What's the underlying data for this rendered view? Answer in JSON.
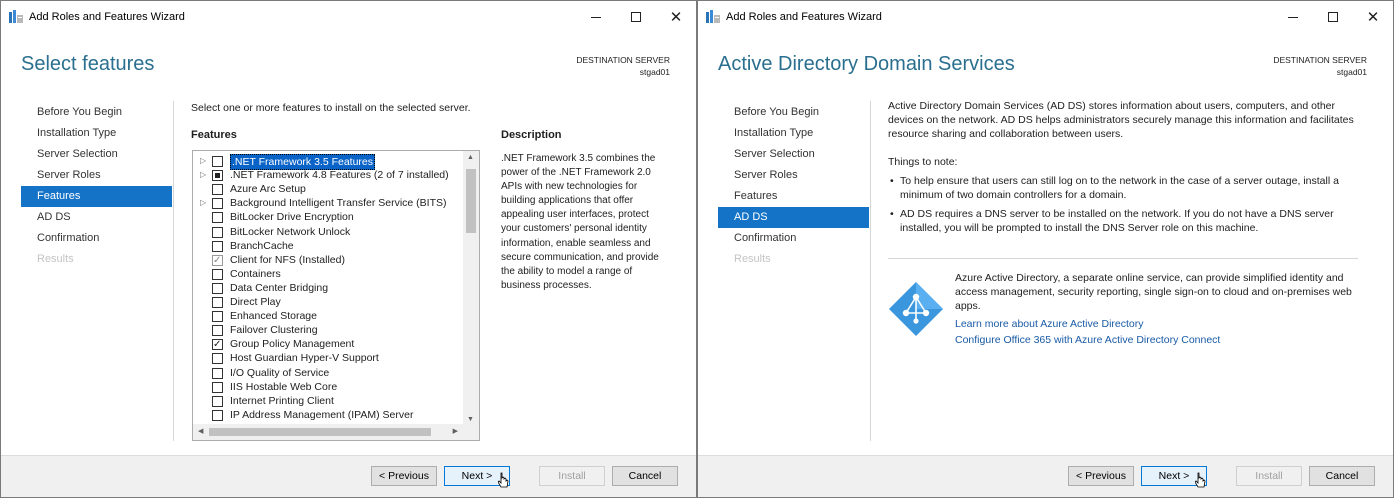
{
  "left": {
    "title": "Add Roles and Features Wizard",
    "heading": "Select features",
    "destination_label": "DESTINATION SERVER",
    "destination_server": "stgad01",
    "nav": [
      {
        "label": "Before You Begin",
        "state": "normal"
      },
      {
        "label": "Installation Type",
        "state": "normal"
      },
      {
        "label": "Server Selection",
        "state": "normal"
      },
      {
        "label": "Server Roles",
        "state": "normal"
      },
      {
        "label": "Features",
        "state": "active"
      },
      {
        "label": "AD DS",
        "state": "normal"
      },
      {
        "label": "Confirmation",
        "state": "normal"
      },
      {
        "label": "Results",
        "state": "disabled"
      }
    ],
    "intro": "Select one or more features to install on the selected server.",
    "features_label": "Features",
    "description_label": "Description",
    "description_text": ".NET Framework 3.5 combines the power of the .NET Framework 2.0 APIs with new technologies for building applications that offer appealing user interfaces, protect your customers' personal identity information, enable seamless and secure communication, and provide the ability to model a range of business processes.",
    "features": [
      {
        "label": ".NET Framework 3.5 Features",
        "expandable": true,
        "state": "unchecked",
        "selected": true
      },
      {
        "label": ".NET Framework 4.8 Features (2 of 7 installed)",
        "expandable": true,
        "state": "partial",
        "selected": false
      },
      {
        "label": "Azure Arc Setup",
        "expandable": false,
        "state": "unchecked",
        "selected": false
      },
      {
        "label": "Background Intelligent Transfer Service (BITS)",
        "expandable": true,
        "state": "unchecked",
        "selected": false
      },
      {
        "label": "BitLocker Drive Encryption",
        "expandable": false,
        "state": "unchecked",
        "selected": false
      },
      {
        "label": "BitLocker Network Unlock",
        "expandable": false,
        "state": "unchecked",
        "selected": false
      },
      {
        "label": "BranchCache",
        "expandable": false,
        "state": "unchecked",
        "selected": false
      },
      {
        "label": "Client for NFS (Installed)",
        "expandable": false,
        "state": "checked-grey",
        "selected": false
      },
      {
        "label": "Containers",
        "expandable": false,
        "state": "unchecked",
        "selected": false
      },
      {
        "label": "Data Center Bridging",
        "expandable": false,
        "state": "unchecked",
        "selected": false
      },
      {
        "label": "Direct Play",
        "expandable": false,
        "state": "unchecked",
        "selected": false
      },
      {
        "label": "Enhanced Storage",
        "expandable": false,
        "state": "unchecked",
        "selected": false
      },
      {
        "label": "Failover Clustering",
        "expandable": false,
        "state": "unchecked",
        "selected": false
      },
      {
        "label": "Group Policy Management",
        "expandable": false,
        "state": "checked",
        "selected": false
      },
      {
        "label": "Host Guardian Hyper-V Support",
        "expandable": false,
        "state": "unchecked",
        "selected": false
      },
      {
        "label": "I/O Quality of Service",
        "expandable": false,
        "state": "unchecked",
        "selected": false
      },
      {
        "label": "IIS Hostable Web Core",
        "expandable": false,
        "state": "unchecked",
        "selected": false
      },
      {
        "label": "Internet Printing Client",
        "expandable": false,
        "state": "unchecked",
        "selected": false
      },
      {
        "label": "IP Address Management (IPAM) Server",
        "expandable": false,
        "state": "unchecked",
        "selected": false
      }
    ],
    "buttons": {
      "previous": "< Previous",
      "next": "Next >",
      "install": "Install",
      "cancel": "Cancel"
    }
  },
  "right": {
    "title": "Add Roles and Features Wizard",
    "heading": "Active Directory Domain Services",
    "destination_label": "DESTINATION SERVER",
    "destination_server": "stgad01",
    "nav": [
      {
        "label": "Before You Begin",
        "state": "normal"
      },
      {
        "label": "Installation Type",
        "state": "normal"
      },
      {
        "label": "Server Selection",
        "state": "normal"
      },
      {
        "label": "Server Roles",
        "state": "normal"
      },
      {
        "label": "Features",
        "state": "normal"
      },
      {
        "label": "AD DS",
        "state": "active"
      },
      {
        "label": "Confirmation",
        "state": "normal"
      },
      {
        "label": "Results",
        "state": "disabled"
      }
    ],
    "intro": "Active Directory Domain Services (AD DS) stores information about users, computers, and other devices on the network.  AD DS helps administrators securely manage this information and facilitates resource sharing and collaboration between users.",
    "notes_label": "Things to note:",
    "bullets": [
      "To help ensure that users can still log on to the network in the case of a server outage, install a minimum of two domain controllers for a domain.",
      "AD DS requires a DNS server to be installed on the network.  If you do not have a DNS server installed, you will be prompted to install the DNS Server role on this machine."
    ],
    "azure_text": "Azure Active Directory, a separate online service, can provide simplified identity and access management, security reporting, single sign-on to cloud and on-premises web apps.",
    "links": [
      "Learn more about Azure Active Directory",
      "Configure Office 365 with Azure Active Directory Connect"
    ],
    "buttons": {
      "previous": "< Previous",
      "next": "Next >",
      "install": "Install",
      "cancel": "Cancel"
    }
  },
  "colors": {
    "accent": "#1473c7",
    "heading": "#2a6f8f",
    "link": "#1a5aa6",
    "azure": "#3a96dd"
  }
}
